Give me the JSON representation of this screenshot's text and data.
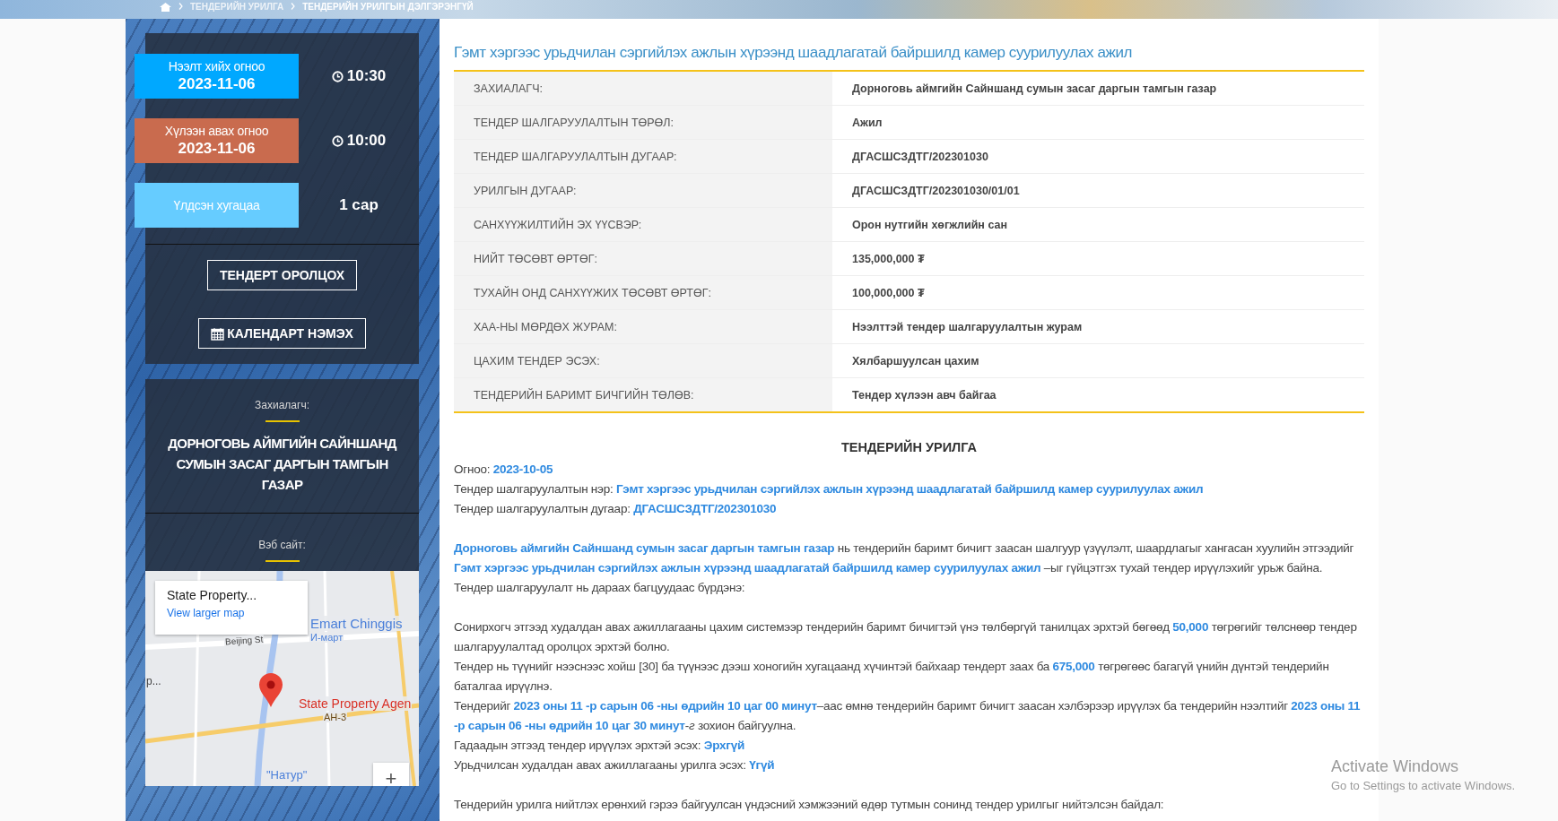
{
  "breadcrumb": [
    {
      "label": "ТЕНДЕРИЙН УРИЛГА"
    },
    {
      "label": "ТЕНДЕРИЙН УРИЛГЫН ДЭЛГЭРЭНГҮЙ"
    }
  ],
  "schedule": [
    {
      "label": "Нээлт хийх огноо",
      "date": "2023-11-06",
      "value": "10:30",
      "kind": "clock",
      "color": "#00a8ff"
    },
    {
      "label": "Хүлээн авах огноо",
      "date": "2023-11-06",
      "value": "10:00",
      "kind": "clock",
      "color": "#c96b4e"
    },
    {
      "label": "Үлдсэн хугацаа",
      "value": "1 сар",
      "kind": "plain",
      "color": "#66ccff"
    }
  ],
  "actions": [
    {
      "label": "ТЕНДЕРТ ОРОЛЦОХ",
      "kind": "plain"
    },
    {
      "label": "КАЛЕНДАРТ НЭМЭХ",
      "kind": "calendar"
    }
  ],
  "customer": {
    "label": "Захиалагч:",
    "name": "ДОРНОГОВЬ АЙМГИЙН САЙНШАНД СУМЫН ЗАСАГ ДАРГЫН ТАМГЫН ГАЗАР"
  },
  "website": {
    "label": "Вэб сайт:"
  },
  "map": {
    "place": "State Property...",
    "link": "View larger map",
    "labels": [
      {
        "text": "Emart Chinggis",
        "kind": "poi"
      },
      {
        "text": "И-март",
        "kind": "poi-sub"
      },
      {
        "text": "Beijing St",
        "kind": "street"
      },
      {
        "text": "State Property Agen",
        "kind": "pin"
      },
      {
        "text": "AH-3",
        "kind": "road"
      },
      {
        "text": "\"Натур\"",
        "kind": "poi-low"
      },
      {
        "text": "р...",
        "kind": "edge"
      }
    ],
    "zoom": "+"
  },
  "title": "Гэмт хэргээс урьдчилан сэргийлэх ажлын хүрээнд шаадлагатай байршилд камер суурилуулах ажил",
  "details": [
    {
      "label": "ЗАХИАЛАГЧ:",
      "value": "Дорноговь аймгийн Сайншанд сумын засаг даргын тамгын газар"
    },
    {
      "label": "ТЕНДЕР ШАЛГАРУУЛАЛТЫН ТӨРӨЛ:",
      "value": "Ажил"
    },
    {
      "label": "ТЕНДЕР ШАЛГАРУУЛАЛТЫН ДУГААР:",
      "value": "ДГАСШСЗДТГ/202301030"
    },
    {
      "label": "УРИЛГЫН ДУГААР:",
      "value": "ДГАСШСЗДТГ/202301030/01/01"
    },
    {
      "label": "САНХҮҮЖИЛТИЙН ЭХ ҮҮСВЭР:",
      "value": "Орон нутгийн хөгжлийн сан"
    },
    {
      "label": "НИЙТ ТӨСӨВТ ӨРТӨГ:",
      "value": "135,000,000 ₮"
    },
    {
      "label": "ТУХАЙН ОНД САНХҮҮЖИХ ТӨСӨВТ ӨРТӨГ:",
      "value": "100,000,000 ₮"
    },
    {
      "label": "ХАА-НЫ МӨРДӨХ ЖУРАМ:",
      "value": "Нээлттэй тендер шалгаруулалтын журам"
    },
    {
      "label": "ЦАХИМ ТЕНДЕР ЭСЭХ:",
      "value": "Хялбаршуулсан цахим"
    },
    {
      "label": "ТЕНДЕРИЙН БАРИМТ БИЧГИЙН ТӨЛӨВ:",
      "value": "Тендер хүлээн авч байгаа"
    }
  ],
  "invitation": {
    "heading": "ТЕНДЕРИЙН УРИЛГА",
    "groups": [
      [
        "Огноо: **2023-10-05**",
        "Тендер шалгаруулалтын нэр: **Гэмт хэргээс урьдчилан сэргийлэх ажлын хүрээнд шаадлагатай байршилд камер суурилуулах ажил**",
        "Тендер шалгаруулалтын дугаар: **ДГАСШСЗДТГ/202301030**"
      ],
      [
        "**Дорноговь аймгийн Сайншанд сумын засаг даргын тамгын газар** нь тендерийн баримт бичигт заасан шалгуур үзүүлэлт, шаардлагыг хангасан хуулийн этгээдийг **Гэмт хэргээс урьдчилан сэргийлэх ажлын хүрээнд шаадлагатай байршилд камер суурилуулах ажил** –ыг гүйцэтгэх тухай тендер ирүүлэхийг урьж байна.",
        "Тендер шалгаруулалт нь дараах багцуудаас бүрдэнэ:"
      ],
      [
        "Сонирхогч этгээд худалдан авах ажиллагааны цахим системээр тендерийн баримт бичигтэй үнэ төлбөргүй танилцах эрхтэй бөгөөд **50,000** төгрөгийг төлснөөр тендер шалгаруулалтад оролцох эрхтэй болно.",
        " Тендер нь түүнийг нээснээс хойш [30] ба түүнээс дээш хоногийн хугацаанд хүчинтэй байхаар тендерт заах ба **675,000** төгрөгөөс багагүй үнийн дүнтэй тендерийн баталгаа ирүүлнэ.",
        "Тендерийг **2023 оны 11 -р сарын 06 -ны өдрийн 10 цаг 00 минут**–аас өмнө тендерийн баримт бичигт заасан хэлбэрээр ирүүлэх ба тендерийн нээлтийг **2023 оны 11 -р сарын 06 -ны өдрийн 10 цаг 30 минут**-*г* зохион байгуулна.",
        "Гадаадын этгээд тендер ирүүлэх эрхтэй эсэх:  **Эрхгүй**",
        "Урьдчилсан худалдан авах ажиллагааны урилга эсэх:  **Үгүй**"
      ],
      [
        "Тендерийн урилга нийтлэх ерөнхий гэрээ байгуулсан үндэсний хэмжээний өдөр тутмын сонинд тендер урилгыг нийтэлсэн байдал:"
      ]
    ]
  },
  "os_notice": {
    "title": "Activate Windows",
    "subtitle": "Go to Settings to activate Windows."
  }
}
